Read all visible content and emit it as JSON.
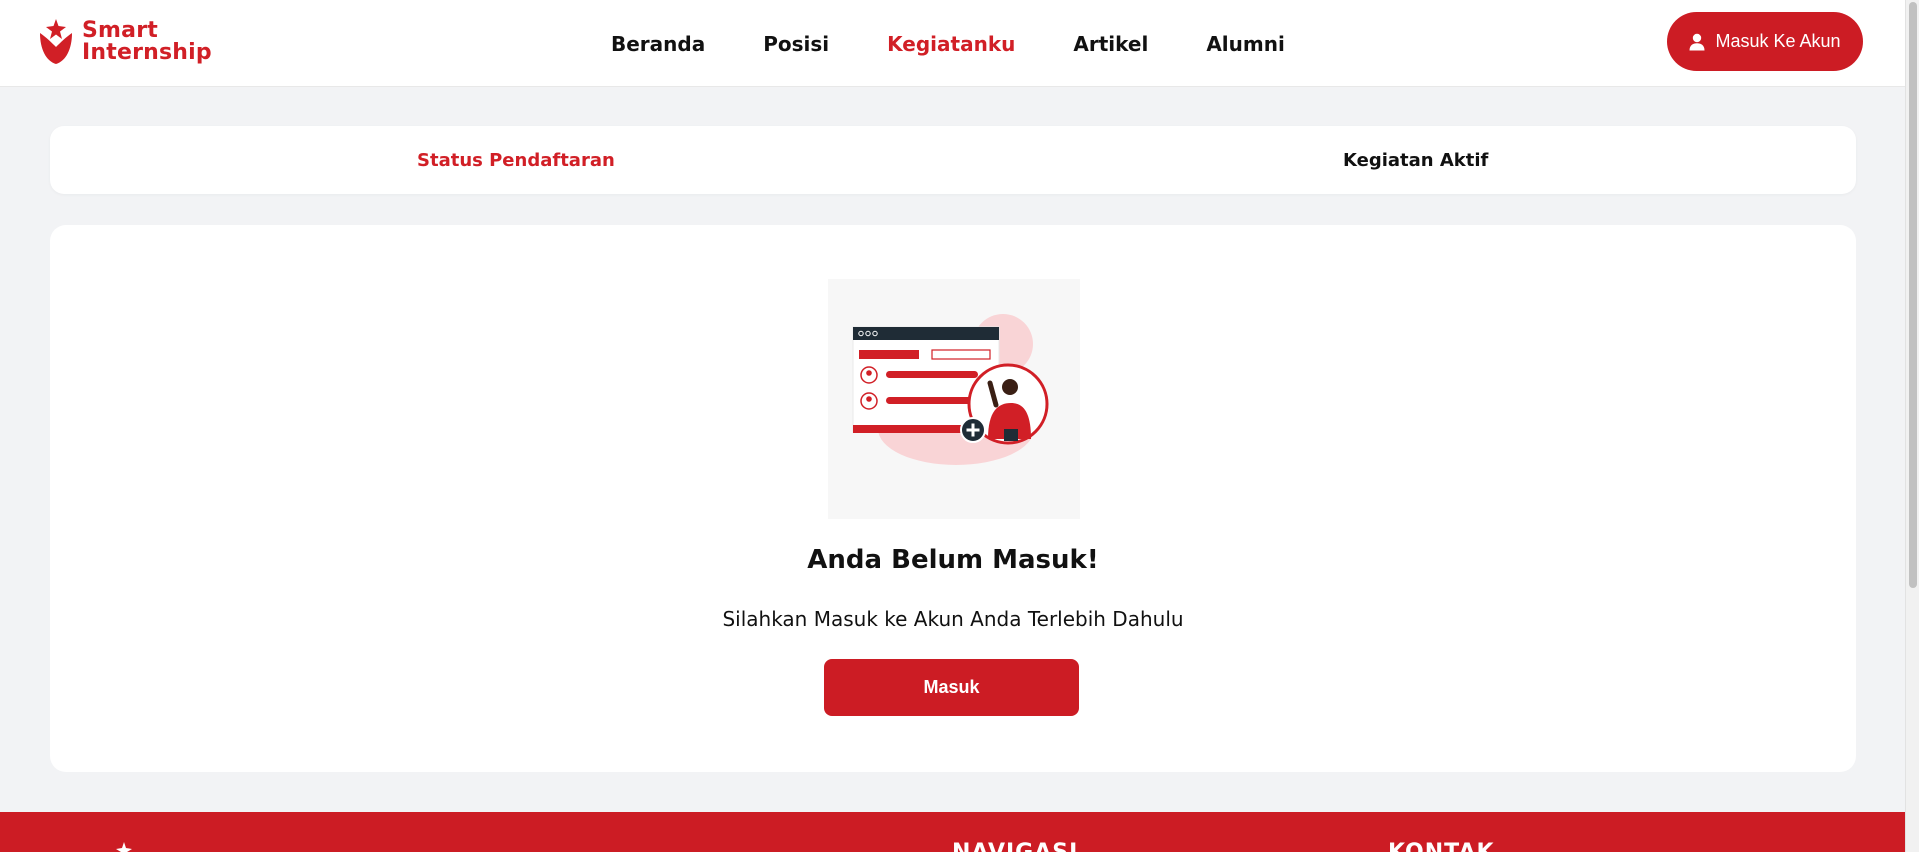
{
  "brand": {
    "line1": "Smart",
    "line2": "Internship",
    "accent": "#d11f26"
  },
  "nav": {
    "items": [
      {
        "label": "Beranda",
        "active": false
      },
      {
        "label": "Posisi",
        "active": false
      },
      {
        "label": "Kegiatanku",
        "active": true
      },
      {
        "label": "Artikel",
        "active": false
      },
      {
        "label": "Alumni",
        "active": false
      }
    ],
    "login_label": "Masuk Ke Akun",
    "login_icon": "user-icon"
  },
  "tabs": [
    {
      "label": "Status Pendaftaran",
      "active": true
    },
    {
      "label": "Kegiatan Aktif",
      "active": false
    }
  ],
  "empty_state": {
    "illustration": "login-required-illustration",
    "title": "Anda Belum Masuk!",
    "subtitle": "Silahkan Masuk ke Akun Anda Terlebih Dahulu",
    "button_label": "Masuk"
  },
  "footer": {
    "headings": [
      "NAVIGASI",
      "KONTAK"
    ]
  }
}
